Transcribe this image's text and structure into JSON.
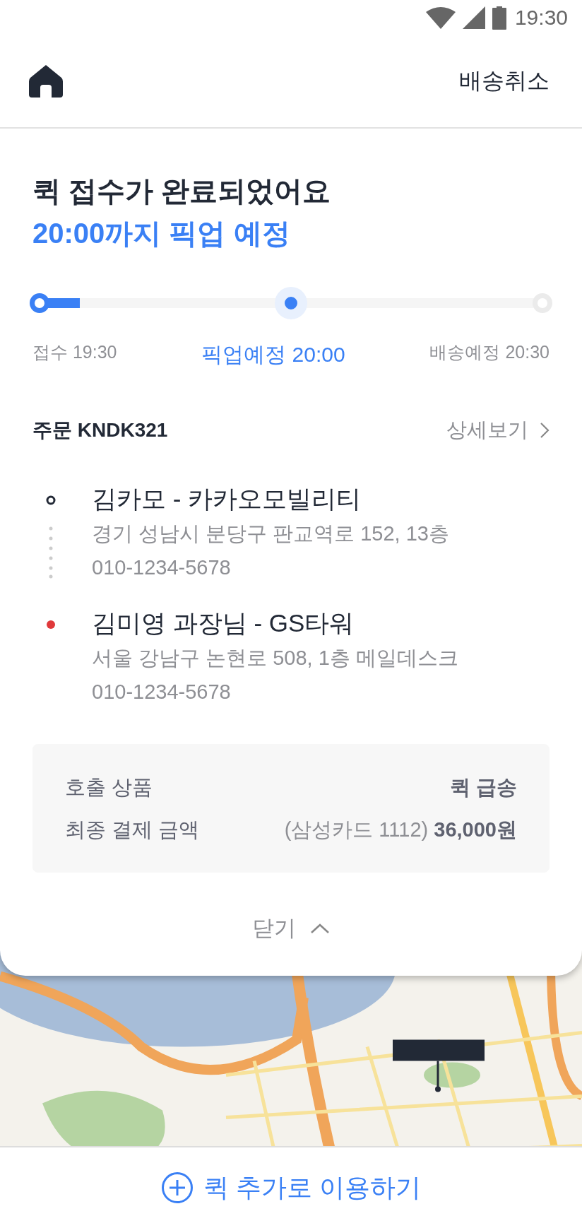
{
  "status_bar": {
    "time": "19:30"
  },
  "header": {
    "action": "배송취소"
  },
  "title": {
    "line1": "퀵 접수가 완료되었어요",
    "line2": "20:00까지 픽업 예정"
  },
  "progress": {
    "level": 0.08,
    "steps": [
      {
        "label": "접수 19:30",
        "selected": false
      },
      {
        "label": "픽업예정 20:00",
        "selected": true
      },
      {
        "label": "배송예정 20:30",
        "selected": false
      }
    ]
  },
  "order": {
    "title": "주문 KNDK321",
    "detail_link": "상세보기"
  },
  "stops": [
    {
      "kind": "origin",
      "name": "김카모 - 카카오모빌리티",
      "address": "경기 성남시 분당구 판교역로 152, 13층",
      "phone": "010-1234-5678"
    },
    {
      "kind": "destination",
      "name": "김미영 과장님 - GS타워",
      "address": "서울 강남구 논현로 508, 1층 메일데스크",
      "phone": "010-1234-5678"
    }
  ],
  "summary": [
    {
      "label": "호출 상품",
      "value": "**퀵 급송**"
    },
    {
      "label": "최종 결제 금액",
      "value": "(삼성카드 1112) **36,000원**"
    }
  ],
  "close_button": "닫기",
  "bottom_button": "퀵 추가로 이용하기"
}
